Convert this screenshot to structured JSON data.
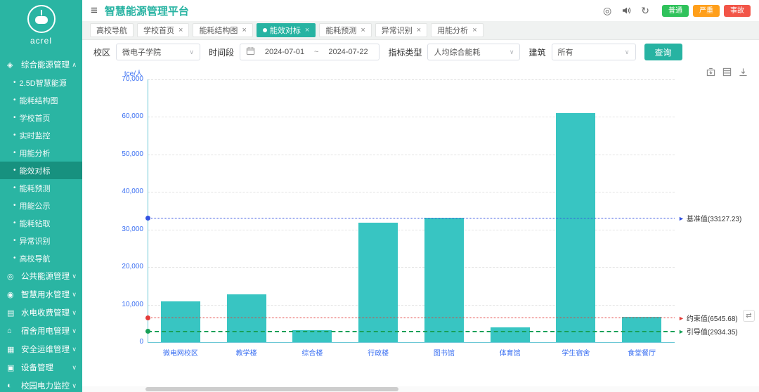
{
  "theme": {
    "accent": "#27b3a2",
    "accent_dark": "#17917f",
    "sidebar_bg": "#2ab5a3",
    "sidebar_active": "#17917f",
    "bar_color": "#38c5c2",
    "axis_color": "#6cc8d6",
    "axis_label": "#3a6ff2"
  },
  "sidebar": {
    "logo_text": "acrel",
    "groups": [
      {
        "label": "综合能源管理",
        "icon": "energy-icon",
        "expanded": true,
        "items": [
          {
            "label": "2.5D智慧能源"
          },
          {
            "label": "能耗结构图"
          },
          {
            "label": "学校首页"
          },
          {
            "label": "实时监控"
          },
          {
            "label": "用能分析"
          },
          {
            "label": "能效对标",
            "active": true
          },
          {
            "label": "能耗预测"
          },
          {
            "label": "用能公示"
          },
          {
            "label": "能耗钻取"
          },
          {
            "label": "异常识别"
          },
          {
            "label": "高校导航"
          }
        ]
      },
      {
        "label": "公共能源管理",
        "icon": "public-energy-icon",
        "expanded": false
      },
      {
        "label": "智慧用水管理",
        "icon": "water-icon",
        "expanded": false
      },
      {
        "label": "水电收费管理",
        "icon": "billing-icon",
        "expanded": false
      },
      {
        "label": "宿舍用电管理",
        "icon": "dorm-icon",
        "expanded": false
      },
      {
        "label": "安全运维管理",
        "icon": "safety-icon",
        "expanded": false
      },
      {
        "label": "设备管理",
        "icon": "device-icon",
        "expanded": false
      },
      {
        "label": "校园电力监控",
        "icon": "power-monitor-icon",
        "expanded": false
      }
    ]
  },
  "header": {
    "title": "智慧能源管理平台",
    "alarm_badges": [
      {
        "label": "普通",
        "color": "#2fc25b"
      },
      {
        "label": "严重",
        "color": "#ff9f1a"
      },
      {
        "label": "事故",
        "color": "#f25548"
      }
    ]
  },
  "tabs": [
    {
      "label": "高校导航",
      "closable": false,
      "active": false
    },
    {
      "label": "学校首页",
      "closable": true,
      "active": false
    },
    {
      "label": "能耗结构图",
      "closable": true,
      "active": false
    },
    {
      "label": "能效对标",
      "closable": true,
      "active": true
    },
    {
      "label": "能耗预测",
      "closable": true,
      "active": false
    },
    {
      "label": "异常识别",
      "closable": true,
      "active": false
    },
    {
      "label": "用能分析",
      "closable": true,
      "active": false
    }
  ],
  "filters": {
    "campus_label": "校区",
    "campus_value": "微电子学院",
    "period_label": "时间段",
    "date_from": "2024-07-01",
    "range_separator": "~",
    "date_to": "2024-07-22",
    "metric_label": "指标类型",
    "metric_value": "人均综合能耗",
    "building_label": "建筑",
    "building_value": "所有",
    "search_button": "查询"
  },
  "chart_data": {
    "type": "bar",
    "title": "",
    "ylabel": "tce/人",
    "categories": [
      "微电网校区",
      "教学楼",
      "综合楼",
      "行政楼",
      "图书馆",
      "体育馆",
      "学生宿舍",
      "食堂餐厅"
    ],
    "values": [
      10800,
      12700,
      3100,
      31800,
      33100,
      3900,
      61000,
      6700
    ],
    "ylim": [
      0,
      70000
    ],
    "ytick_step": 10000,
    "grid": true,
    "legend_position": "none",
    "ref_lines": [
      {
        "name": "基准值",
        "value": 33127.23,
        "color": "#3352e1",
        "style": "dotted"
      },
      {
        "name": "约束值",
        "value": 6545.68,
        "color": "#e33c39",
        "style": "dotted"
      },
      {
        "name": "引导值",
        "value": 2934.35,
        "color": "#18a058",
        "style": "dashed"
      }
    ]
  }
}
